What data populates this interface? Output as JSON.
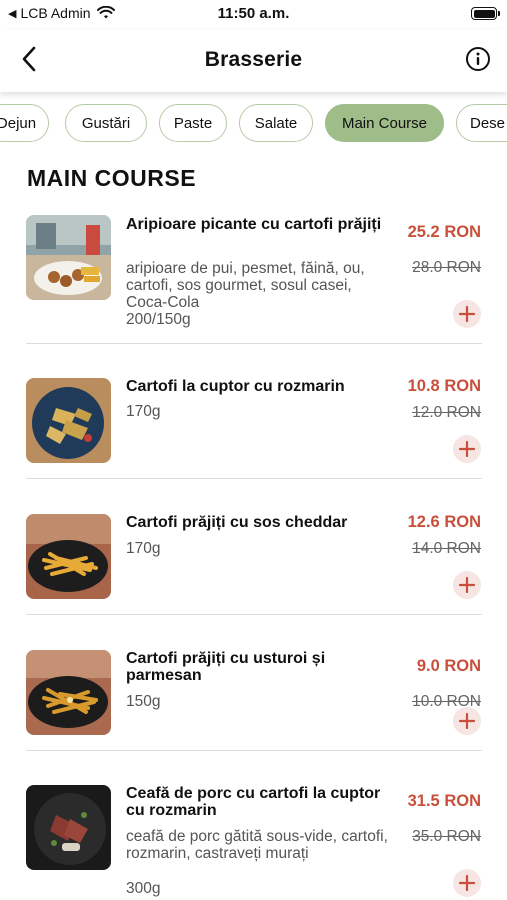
{
  "status_bar": {
    "carrier": "LCB Admin",
    "time": "11:50 a.m."
  },
  "header": {
    "title": "Brasserie",
    "back_icon": "chevron-left-icon",
    "info_icon": "info-circle-icon"
  },
  "tabs": [
    {
      "label": "Dejun",
      "active": false
    },
    {
      "label": "Gustări",
      "active": false
    },
    {
      "label": "Paste",
      "active": false
    },
    {
      "label": "Salate",
      "active": false
    },
    {
      "label": "Main Course",
      "active": true
    },
    {
      "label": "Dese",
      "active": false
    }
  ],
  "section": {
    "title": "MAIN COURSE"
  },
  "items": [
    {
      "name": "Aripioare picante cu cartofi prăjiți",
      "description": "aripioare de pui, pesmet, făină, ou, cartofi, sos gourmet, sosul casei, Coca-Cola",
      "weight": "200/150g",
      "price": "25.2 RON",
      "old_price": "28.0 RON"
    },
    {
      "name": "Cartofi la cuptor cu rozmarin",
      "description": "",
      "weight": "170g",
      "price": "10.8 RON",
      "old_price": "12.0 RON"
    },
    {
      "name": "Cartofi prăjiți cu sos cheddar",
      "description": "",
      "weight": "170g",
      "price": "12.6 RON",
      "old_price": "14.0 RON"
    },
    {
      "name": "Cartofi prăjiți cu usturoi și parmesan",
      "description": "",
      "weight": "150g",
      "price": "9.0 RON",
      "old_price": "10.0 RON"
    },
    {
      "name": "Ceafă de porc cu cartofi la cuptor cu rozmarin",
      "description": "ceafă de porc gătită sous-vide, cartofi, rozmarin, castraveți murați",
      "weight": "300g",
      "price": "31.5 RON",
      "old_price": "35.0 RON"
    }
  ],
  "colors": {
    "accent_green": "#9fbd89",
    "price_red": "#c8503a",
    "add_bg": "#f6e5e2"
  }
}
